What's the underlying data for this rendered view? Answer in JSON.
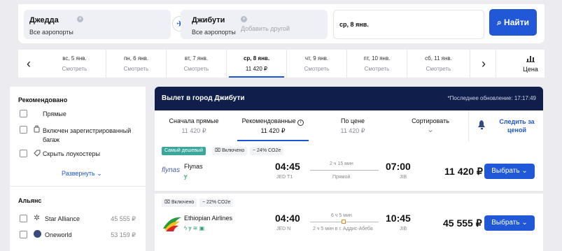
{
  "search": {
    "from_city": "Джедда",
    "from_sub": "Все аэропорты",
    "to_city": "Джибути",
    "to_sub": "Все аэропорты",
    "add_placeholder": "Добавить другой",
    "date": "ср, 8 янв.",
    "find_label": "Найти"
  },
  "dates": {
    "items": [
      {
        "day": "вс, 5 янв.",
        "value": "Смотреть"
      },
      {
        "day": "пн, 6 янв.",
        "value": "Смотреть"
      },
      {
        "day": "вт, 7 янв.",
        "value": "Смотреть"
      },
      {
        "day": "ср, 8 янв.",
        "value": "11 420 ₽"
      },
      {
        "day": "чт, 9 янв.",
        "value": "Смотреть"
      },
      {
        "day": "пт, 10 янв.",
        "value": "Смотреть"
      },
      {
        "day": "сб, 11 янв.",
        "value": "Смотреть"
      }
    ],
    "price_label": "Цена"
  },
  "filters": {
    "recommended_title": "Рекомендовано",
    "direct": "Прямые",
    "baggage": "Включен зарегистрированный багаж",
    "hide_lowcost": "Скрыть лоукостеры",
    "expand": "Развернуть",
    "alliance_title": "Альянс",
    "alliances": [
      {
        "name": "Star Alliance",
        "price": "45 555 ₽"
      },
      {
        "name": "Oneworld",
        "price": "53 159 ₽"
      }
    ]
  },
  "results": {
    "title": "Вылет в город Джибути",
    "updated": "*Последнее обновление: 17:17:49",
    "sort": {
      "cheap_first": "Сначала прямые",
      "cheap_first_price": "11 420 ₽",
      "recommended": "Рекомендованные",
      "recommended_price": "11 420 ₽",
      "by_price": "По цене",
      "by_price_price": "11 420 ₽",
      "sort_label": "Сортировать",
      "subscribe": "Следить за ценой"
    },
    "flights": [
      {
        "badge_cheapest": "Самый дешевый",
        "included": "Включено",
        "co2": "− 24% CO2e",
        "airline_logo": "flynas",
        "airline": "Flynas",
        "dep_time": "04:45",
        "dep_airport": "JED T1",
        "duration": "2 ч 15 мин",
        "stops": "Прямой",
        "arr_time": "07:00",
        "arr_airport": "JIB",
        "price": "11 420 ₽",
        "select": "Выбрать"
      },
      {
        "included": "Включено",
        "co2": "− 22% CO2e",
        "airline": "Ethiopian Airlines",
        "dep_time": "04:40",
        "dep_airport": "JED N",
        "duration": "6 ч 5 мин",
        "stops": "2 ч 5 мин в г. Аддис-Абеба",
        "arr_time": "10:45",
        "arr_airport": "JIB",
        "price": "45 555 ₽",
        "select": "Выбрать"
      }
    ]
  }
}
